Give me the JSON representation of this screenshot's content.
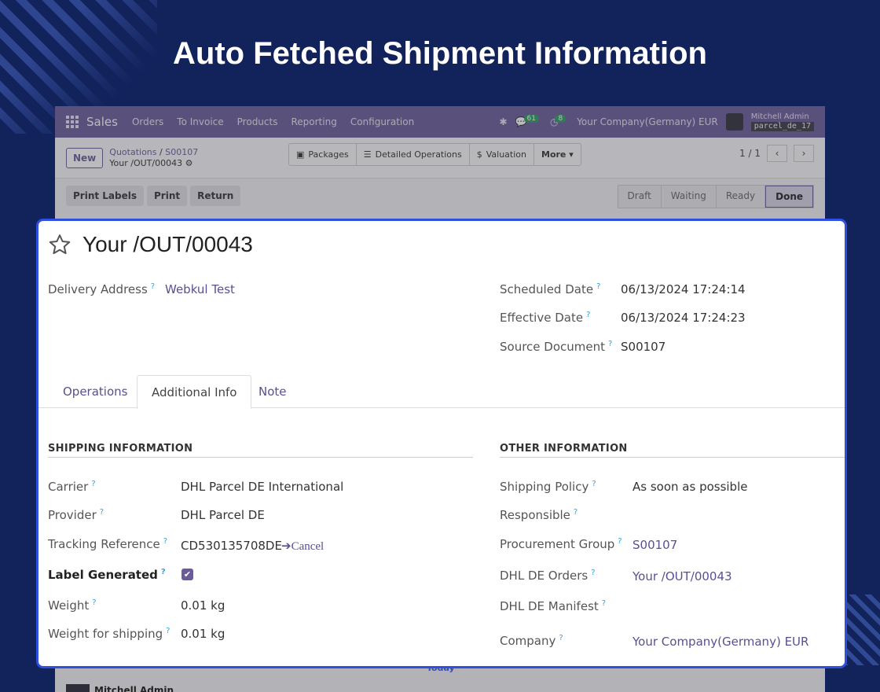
{
  "banner": {
    "title": "Auto Fetched Shipment Information"
  },
  "topnav": {
    "app_name": "Sales",
    "menus": [
      "Orders",
      "To Invoice",
      "Products",
      "Reporting",
      "Configuration"
    ],
    "messages_count": "61",
    "activities_count": "8",
    "company": "Your Company(Germany) EUR",
    "user_name": "Mitchell Admin",
    "database": "parcel_de_17"
  },
  "controlbar": {
    "new_label": "New",
    "breadcrumb_parent": "Quotations",
    "breadcrumb_sep": "/",
    "breadcrumb_order": "S00107",
    "breadcrumb_current": "Your /OUT/00043",
    "smart_buttons": [
      "Packages",
      "Detailed Operations",
      "Valuation",
      "More ▾"
    ],
    "pager": "1 / 1"
  },
  "actionbar": {
    "buttons": [
      "Print Labels",
      "Print",
      "Return"
    ],
    "statuses": [
      "Draft",
      "Waiting",
      "Ready",
      "Done"
    ]
  },
  "record": {
    "title": "Your /OUT/00043",
    "delivery_address_label": "Delivery Address",
    "delivery_address": "Webkul Test",
    "scheduled_date_label": "Scheduled Date",
    "scheduled_date": "06/13/2024 17:24:14",
    "effective_date_label": "Effective Date",
    "effective_date": "06/13/2024 17:24:23",
    "source_document_label": "Source Document",
    "source_document": "S00107"
  },
  "tabs": [
    "Operations",
    "Additional Info",
    "Note"
  ],
  "shipping": {
    "heading": "SHIPPING INFORMATION",
    "carrier_label": "Carrier",
    "carrier": "DHL Parcel DE International",
    "provider_label": "Provider",
    "provider": "DHL Parcel DE",
    "tracking_label": "Tracking Reference",
    "tracking": "CD530135708DE",
    "cancel_label": "➔Cancel",
    "label_generated_label": "Label Generated",
    "label_generated": "✔",
    "weight_label": "Weight",
    "weight": "0.01 kg",
    "weight_shipping_label": "Weight for shipping",
    "weight_shipping": "0.01 kg"
  },
  "other": {
    "heading": "OTHER INFORMATION",
    "shipping_policy_label": "Shipping Policy",
    "shipping_policy": "As soon as possible",
    "responsible_label": "Responsible",
    "procurement_label": "Procurement Group",
    "procurement": "S00107",
    "dhl_orders_label": "DHL DE Orders",
    "dhl_orders": "Your /OUT/00043",
    "dhl_manifest_label": "DHL DE Manifest",
    "company_label": "Company",
    "company": "Your Company(Germany) EUR"
  },
  "help_mark": "?",
  "chatter": {
    "date_separator": "Today",
    "author": "Mitchell Admin"
  }
}
